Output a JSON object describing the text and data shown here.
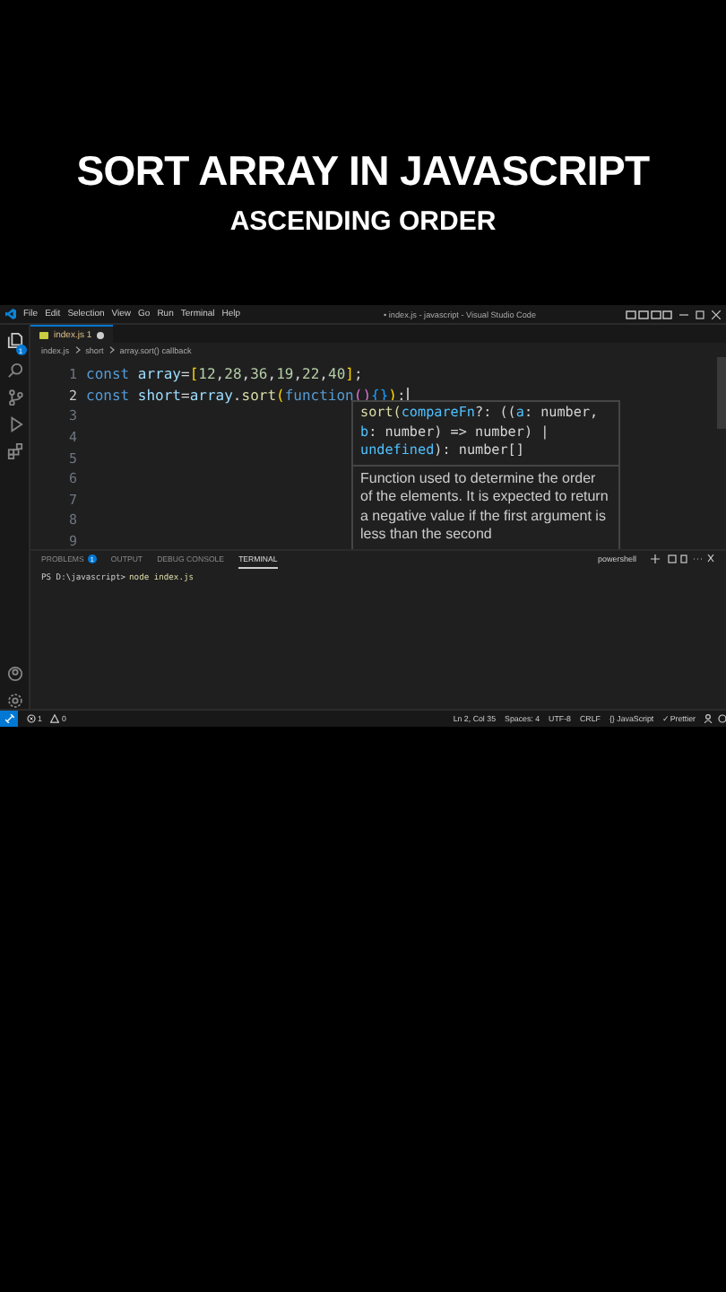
{
  "video_title": {
    "line_1": "SORT ARRAY IN JAVASCRIPT",
    "line_2": "ASCENDING ORDER"
  },
  "window": {
    "menu": [
      "File",
      "Edit",
      "Selection",
      "View",
      "Go",
      "Run",
      "Terminal",
      "Help"
    ],
    "title": "• index.js - javascript - Visual Studio Code"
  },
  "activity_bar": {
    "explorer_badge": "1"
  },
  "tabs": [
    {
      "label": "index.js",
      "problems": "1",
      "modified": true,
      "selected": true
    }
  ],
  "breadcrumb": [
    "index.js",
    "short",
    "array.sort() callback"
  ],
  "editor": {
    "lines": [
      {
        "number": "1",
        "tokens": [
          {
            "kind": "keyword",
            "text": "const "
          },
          {
            "kind": "variable",
            "text": "array"
          },
          {
            "kind": "punct",
            "text": "="
          },
          {
            "kind": "bracket",
            "text": "["
          },
          {
            "kind": "number",
            "text": "12"
          },
          {
            "kind": "punct",
            "text": ","
          },
          {
            "kind": "number",
            "text": "28"
          },
          {
            "kind": "punct",
            "text": ","
          },
          {
            "kind": "number",
            "text": "36"
          },
          {
            "kind": "punct",
            "text": ","
          },
          {
            "kind": "number",
            "text": "19"
          },
          {
            "kind": "punct",
            "text": ","
          },
          {
            "kind": "number",
            "text": "22"
          },
          {
            "kind": "punct",
            "text": ","
          },
          {
            "kind": "number",
            "text": "40"
          },
          {
            "kind": "bracket",
            "text": "]"
          },
          {
            "kind": "punct",
            "text": ";"
          }
        ]
      },
      {
        "number": "2",
        "current": true,
        "tokens": [
          {
            "kind": "keyword",
            "text": "const "
          },
          {
            "kind": "variable",
            "text": "short"
          },
          {
            "kind": "punct",
            "text": "="
          },
          {
            "kind": "variable",
            "text": "array"
          },
          {
            "kind": "punct",
            "text": "."
          },
          {
            "kind": "function",
            "text": "sort"
          },
          {
            "kind": "bracket",
            "text": "("
          },
          {
            "kind": "keyword",
            "text": "function"
          },
          {
            "kind": "bracket2",
            "text": "()"
          },
          {
            "kind": "bracket3",
            "text": "{}"
          },
          {
            "kind": "bracket",
            "text": ")"
          },
          {
            "kind": "punct",
            "text": ";"
          }
        ]
      },
      {
        "number": "3"
      },
      {
        "number": "4"
      },
      {
        "number": "5"
      },
      {
        "number": "6"
      },
      {
        "number": "7"
      },
      {
        "number": "8"
      },
      {
        "number": "9"
      }
    ],
    "hover": {
      "signature": [
        {
          "kind": "function",
          "text": "sort("
        },
        {
          "kind": "param",
          "text": "compareFn"
        },
        {
          "kind": "punct",
          "text": "?: (("
        },
        {
          "kind": "param",
          "text": "a"
        },
        {
          "kind": "punct",
          "text": ": number, "
        },
        {
          "kind": "param",
          "text": "b"
        },
        {
          "kind": "punct",
          "text": ": number) => number) | "
        },
        {
          "kind": "param",
          "text": "undefined"
        },
        {
          "kind": "punct",
          "text": "): number[]"
        }
      ],
      "doc": "Function used to determine the order of the elements. It is expected to return a negative value if the first argument is less than the second"
    }
  },
  "panel": {
    "tabs": [
      {
        "label": "PROBLEMS",
        "count": "1",
        "selected": false
      },
      {
        "label": "OUTPUT",
        "selected": false
      },
      {
        "label": "DEBUG CONSOLE",
        "selected": false
      },
      {
        "label": "TERMINAL",
        "selected": true
      }
    ],
    "shell": "powershell",
    "terminal": {
      "prompt": "PS D:\\javascript>",
      "command": "node index.js"
    }
  },
  "status_bar": {
    "errors": "1",
    "warnings": "0",
    "items": [
      "Ln 2, Col 35",
      "Spaces: 4",
      "UTF-8",
      "CRLF",
      "{} JavaScript",
      "✓ Prettier"
    ]
  }
}
